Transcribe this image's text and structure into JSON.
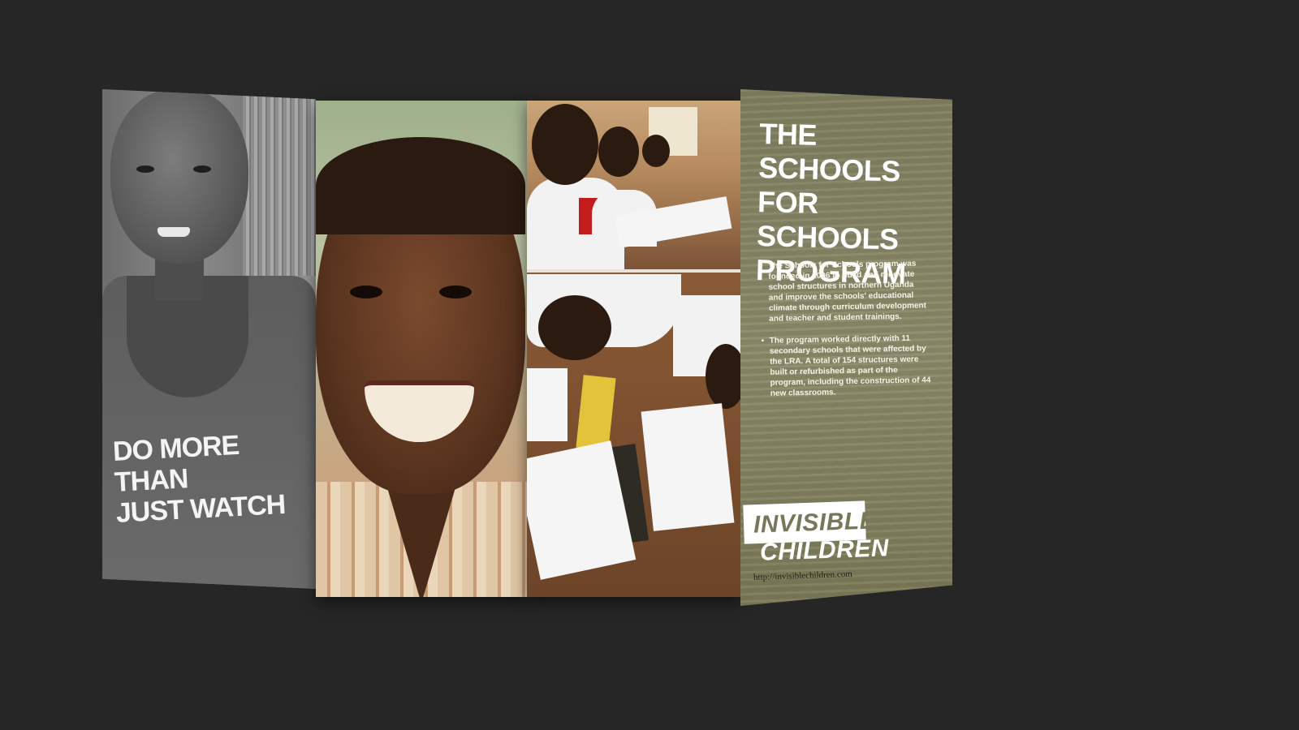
{
  "brochure": {
    "panel1": {
      "shirt_line1": "DO MORE THAN",
      "shirt_line2": "JUST WATCH"
    },
    "panel4": {
      "title_line1": "THE SCHOOLS",
      "title_line2": "FOR SCHOOLS",
      "title_line3": "PROGRAM",
      "bullets": [
        "The Schools for Schools program was founded in 2006 to build and renovate school structures in northern Uganda and improve the schools' educational climate through curriculum development and teacher and student trainings.",
        "The program worked directly with 11 secondary schools that were affected by the LRA. A total of 154 structures were built or refurbished as part of the program, including the construction of 44 new classrooms."
      ],
      "logo_line1": "INVISIBLE",
      "logo_line2": "CHILDREN",
      "url": "http://invisiblechildren.com"
    }
  },
  "colors": {
    "background": "#262626",
    "panel_olive": "#84836a"
  }
}
